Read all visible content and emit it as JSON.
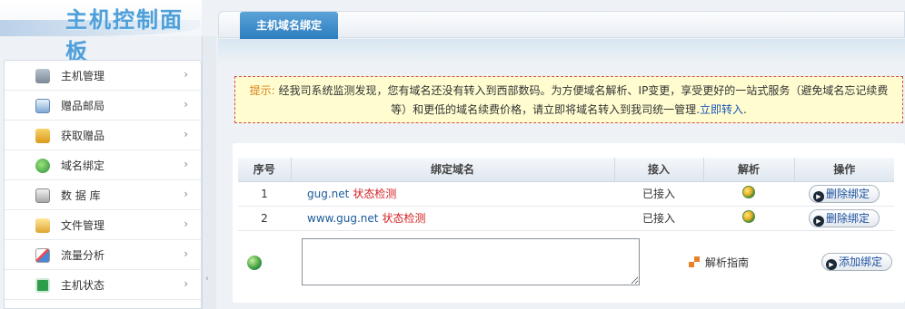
{
  "logo": {
    "title": "主机控制面板"
  },
  "sidebar": {
    "items": [
      {
        "label": "主机管理",
        "icon": "server-icon"
      },
      {
        "label": "赠品邮局",
        "icon": "mail-icon"
      },
      {
        "label": "获取赠品",
        "icon": "gift-icon"
      },
      {
        "label": "域名绑定",
        "icon": "globe-icon"
      },
      {
        "label": "数 据 库",
        "icon": "database-icon"
      },
      {
        "label": "文件管理",
        "icon": "folder-icon"
      },
      {
        "label": "流量分析",
        "icon": "chart-icon"
      },
      {
        "label": "主机状态",
        "icon": "status-icon"
      }
    ],
    "arrow": "›",
    "collapse_arrow": "‹"
  },
  "tab": {
    "label": "主机域名绑定"
  },
  "notice": {
    "prefix": "提示:",
    "text": " 经我司系统监测发现，您有域名还没有转入到西部数码。为方便域名解析、IP变更，享受更好的一站式服务（避免域名忘记续费等）和更低的域名续费价格，请立即将域名转入到我司统一管理.",
    "link": "立即转入",
    "suffix": "."
  },
  "table": {
    "headers": [
      "序号",
      "绑定域名",
      "接入",
      "解析",
      "操作"
    ],
    "rows": [
      {
        "index": "1",
        "domain": "gug.net",
        "check": "状态检测",
        "access": "已接入",
        "action": "删除绑定"
      },
      {
        "index": "2",
        "domain": "www.gug.net",
        "check": "状态检测",
        "access": "已接入",
        "action": "删除绑定"
      }
    ]
  },
  "add": {
    "input_value": "",
    "guide_label": "解析指南",
    "button_label": "添加绑定"
  },
  "colors": {
    "accent": "#2d7dbf",
    "notice_bg": "#fffdd0",
    "danger": "#d42020"
  }
}
